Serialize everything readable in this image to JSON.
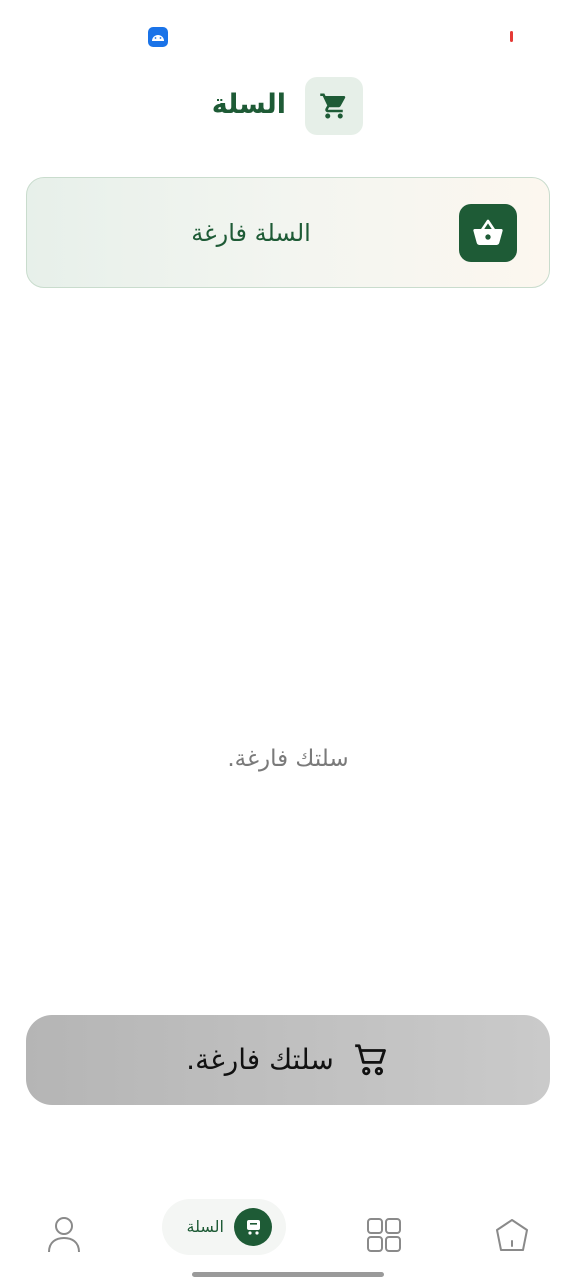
{
  "header": {
    "title": "السلة",
    "icon": "cart-icon"
  },
  "banner": {
    "text": "السلة فارغة",
    "icon": "basket-icon"
  },
  "main": {
    "empty_message": "سلتك فارغة."
  },
  "checkout": {
    "label": "سلتك فارغة.",
    "icon": "cart-icon"
  },
  "bottom_nav": {
    "items": [
      {
        "icon": "profile-icon"
      },
      {
        "label": "السلة",
        "icon": "cart-icon",
        "active": true
      },
      {
        "icon": "grid-icon"
      },
      {
        "icon": "home-icon"
      }
    ]
  },
  "colors": {
    "brand_green": "#1e5b36",
    "light_green": "#e6efe8",
    "checkout_gray": "#c2c2c2"
  }
}
